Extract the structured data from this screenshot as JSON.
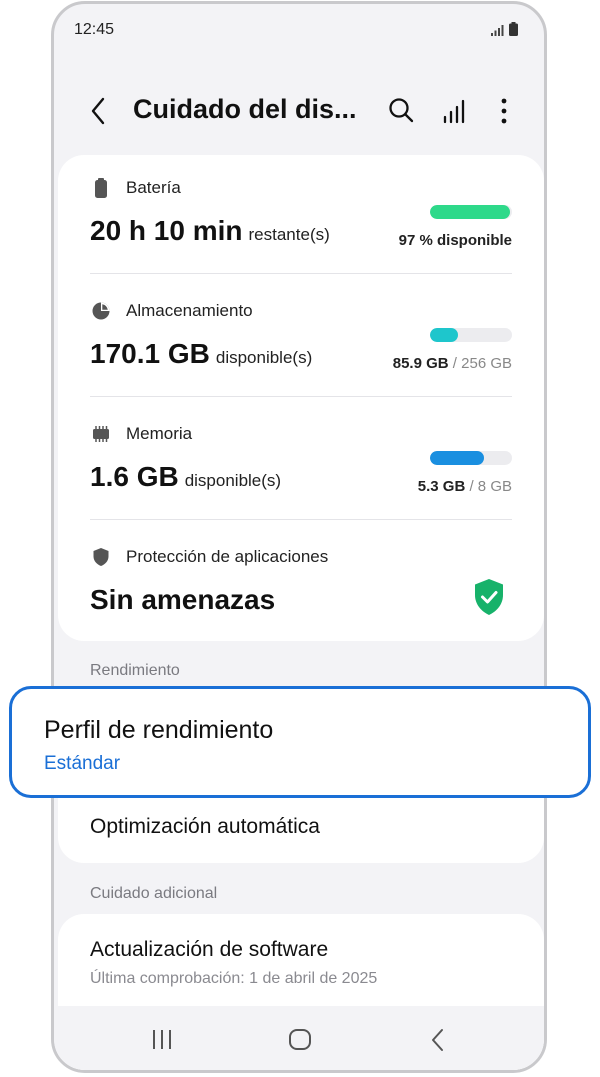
{
  "status_bar": {
    "time": "12:45"
  },
  "app_bar": {
    "title": "Cuidado del dis..."
  },
  "battery": {
    "label": "Batería",
    "value": "20 h 10 min",
    "unit": "restante(s)",
    "caption": "97 % disponible",
    "level": 0.97,
    "color": "#2ed98a"
  },
  "storage": {
    "label": "Almacenamiento",
    "value": "170.1 GB",
    "unit": "disponible(s)",
    "used": "85.9 GB",
    "total": "/ 256 GB",
    "level": 0.34,
    "color": "#1ec6cc"
  },
  "memory": {
    "label": "Memoria",
    "value": "1.6 GB",
    "unit": "disponible(s)",
    "used": "5.3 GB",
    "total": "/ 8 GB",
    "level": 0.66,
    "color": "#1a8fe0"
  },
  "protection": {
    "label": "Protección de aplicaciones",
    "value": "Sin amenazas",
    "color": "#17b26a"
  },
  "performance": {
    "header": "Rendimiento",
    "profile_title": "Perfil de rendimiento",
    "profile_value": "Estándar",
    "auto_optimization": "Optimización automática"
  },
  "additional": {
    "header": "Cuidado adicional",
    "software_update": "Actualización de software",
    "last_check": "Última comprobación: 1 de abril de 2025"
  },
  "colors": {
    "accent": "#1a6fd6"
  }
}
